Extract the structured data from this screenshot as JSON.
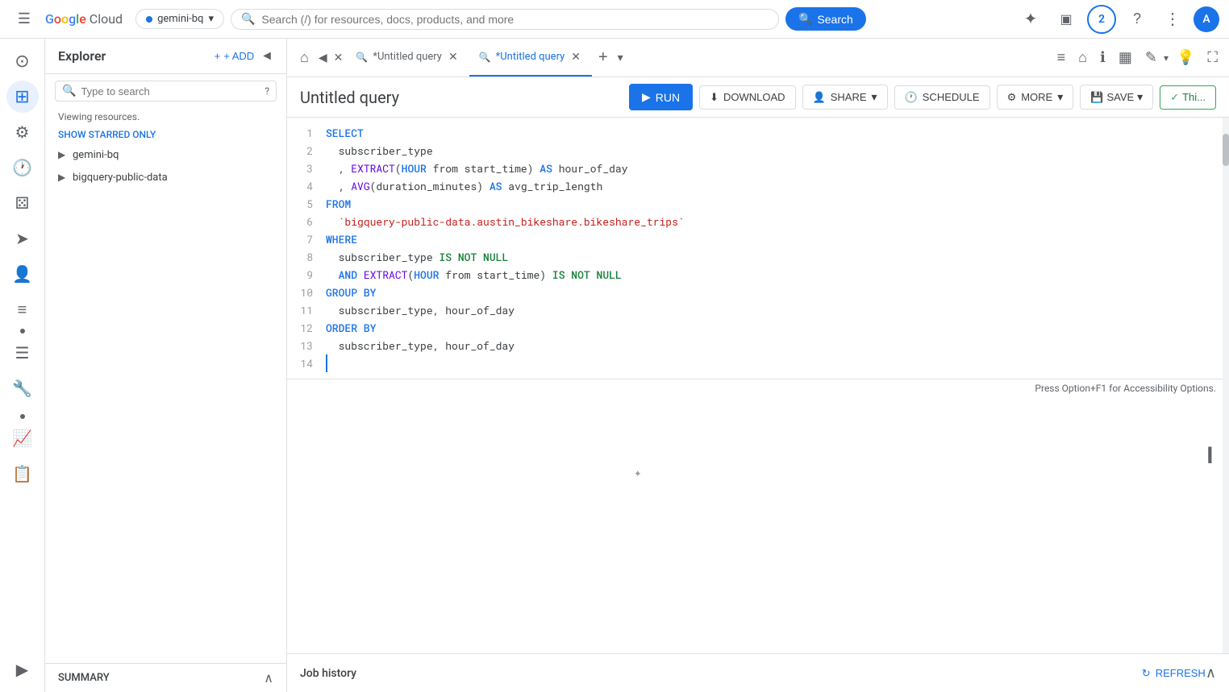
{
  "topNav": {
    "hamburger_label": "☰",
    "logo_text": "Google Cloud",
    "project_name": "gemini-bq",
    "search_placeholder": "Search (/) for resources, docs, products, and more",
    "search_button_label": "Search",
    "notification_count": "2",
    "avatar_letter": "A"
  },
  "sidebar": {
    "title": "Explorer",
    "add_label": "+ ADD",
    "collapse_label": "◄",
    "search_placeholder": "Type to search",
    "help_label": "?",
    "viewing_label": "Viewing resources.",
    "show_starred_label": "SHOW STARRED ONLY",
    "tree_items": [
      {
        "id": "gemini-bq",
        "label": "gemini-bq",
        "starred": false,
        "star_filled": false
      },
      {
        "id": "bigquery-public-data",
        "label": "bigquery-public-data",
        "starred": true,
        "star_filled": true
      }
    ],
    "summary_label": "SUMMARY",
    "chevron_up": "∧"
  },
  "tabs": {
    "home_icon": "⌂",
    "items": [
      {
        "id": "tab1",
        "label": "*Untitled query",
        "icon": "🔍",
        "active": false,
        "closeable": true
      },
      {
        "id": "tab2",
        "label": "*Untitled query",
        "icon": "🔍",
        "active": true,
        "closeable": true
      }
    ],
    "add_label": "+",
    "more_label": "▾",
    "toolbar_icons": [
      {
        "id": "list-icon",
        "symbol": "≡",
        "tooltip": "list"
      },
      {
        "id": "home-icon",
        "symbol": "⌂",
        "tooltip": "home"
      },
      {
        "id": "info-icon",
        "symbol": "ℹ",
        "tooltip": "info"
      },
      {
        "id": "table-icon",
        "symbol": "▦",
        "tooltip": "table"
      },
      {
        "id": "pencil-icon",
        "symbol": "✎",
        "tooltip": "edit"
      },
      {
        "id": "lightbulb-icon",
        "symbol": "💡",
        "tooltip": "suggestions"
      },
      {
        "id": "fullscreen-icon",
        "symbol": "⛶",
        "tooltip": "fullscreen"
      }
    ]
  },
  "queryToolbar": {
    "title": "Untitled query",
    "run_label": "▶ RUN",
    "download_label": "DOWNLOAD",
    "share_label": "SHARE",
    "schedule_label": "SCHEDULE",
    "more_label": "MORE",
    "save_label": "SAVE",
    "validated_label": "Thi..."
  },
  "codeEditor": {
    "lines": [
      {
        "num": 1,
        "content": "SELECT",
        "tokens": [
          {
            "text": "SELECT",
            "type": "kw-blue"
          }
        ]
      },
      {
        "num": 2,
        "content": "  subscriber_type",
        "tokens": [
          {
            "text": "  subscriber_type",
            "type": "plain"
          }
        ]
      },
      {
        "num": 3,
        "content": "  , EXTRACT(HOUR from start_time) AS hour_of_day",
        "tokens": [
          {
            "text": "  , ",
            "type": "plain"
          },
          {
            "text": "EXTRACT",
            "type": "fn-purple"
          },
          {
            "text": "(",
            "type": "plain"
          },
          {
            "text": "HOUR",
            "type": "kw-blue"
          },
          {
            "text": " from start_time) ",
            "type": "plain"
          },
          {
            "text": "AS",
            "type": "kw-blue"
          },
          {
            "text": " hour_of_day",
            "type": "plain"
          }
        ]
      },
      {
        "num": 4,
        "content": "  , AVG(duration_minutes) AS avg_trip_length",
        "tokens": [
          {
            "text": "  , ",
            "type": "plain"
          },
          {
            "text": "AVG",
            "type": "fn-purple"
          },
          {
            "text": "(duration_minutes) ",
            "type": "plain"
          },
          {
            "text": "AS",
            "type": "kw-blue"
          },
          {
            "text": " avg_trip_length",
            "type": "plain"
          }
        ]
      },
      {
        "num": 5,
        "content": "FROM",
        "tokens": [
          {
            "text": "FROM",
            "type": "kw-blue"
          }
        ]
      },
      {
        "num": 6,
        "content": "  `bigquery-public-data.austin_bikeshare.bikeshare_trips`",
        "tokens": [
          {
            "text": "  ",
            "type": "plain"
          },
          {
            "text": "`bigquery-public-data.austin_bikeshare.bikeshare_trips`",
            "type": "str-backtick"
          }
        ]
      },
      {
        "num": 7,
        "content": "WHERE",
        "tokens": [
          {
            "text": "WHERE",
            "type": "kw-blue"
          }
        ]
      },
      {
        "num": 8,
        "content": "  subscriber_type IS NOT NULL",
        "tokens": [
          {
            "text": "  subscriber_type ",
            "type": "plain"
          },
          {
            "text": "IS NOT NULL",
            "type": "kw-teal"
          }
        ]
      },
      {
        "num": 9,
        "content": "  AND EXTRACT(HOUR from start_time) IS NOT NULL",
        "tokens": [
          {
            "text": "  ",
            "type": "plain"
          },
          {
            "text": "AND",
            "type": "kw-blue"
          },
          {
            "text": " ",
            "type": "plain"
          },
          {
            "text": "EXTRACT",
            "type": "fn-purple"
          },
          {
            "text": "(",
            "type": "plain"
          },
          {
            "text": "HOUR",
            "type": "kw-blue"
          },
          {
            "text": " from start_time) ",
            "type": "plain"
          },
          {
            "text": "IS NOT NULL",
            "type": "kw-teal"
          }
        ]
      },
      {
        "num": 10,
        "content": "GROUP BY",
        "tokens": [
          {
            "text": "GROUP BY",
            "type": "kw-blue"
          }
        ]
      },
      {
        "num": 11,
        "content": "  subscriber_type, hour_of_day",
        "tokens": [
          {
            "text": "  subscriber_type, hour_of_day",
            "type": "plain"
          }
        ]
      },
      {
        "num": 12,
        "content": "ORDER BY",
        "tokens": [
          {
            "text": "ORDER BY",
            "type": "kw-blue"
          }
        ]
      },
      {
        "num": 13,
        "content": "  subscriber_type, hour_of_day",
        "tokens": [
          {
            "text": "  subscriber_type, hour_of_day",
            "type": "plain"
          }
        ]
      },
      {
        "num": 14,
        "content": "  ",
        "tokens": [
          {
            "text": "  ",
            "type": "cursor-line"
          }
        ]
      }
    ],
    "accessibility_note": "Press Option+F1 for Accessibility Options."
  },
  "jobHistory": {
    "label": "Job history",
    "refresh_label": "↻ REFRESH",
    "expand_label": "∧"
  }
}
